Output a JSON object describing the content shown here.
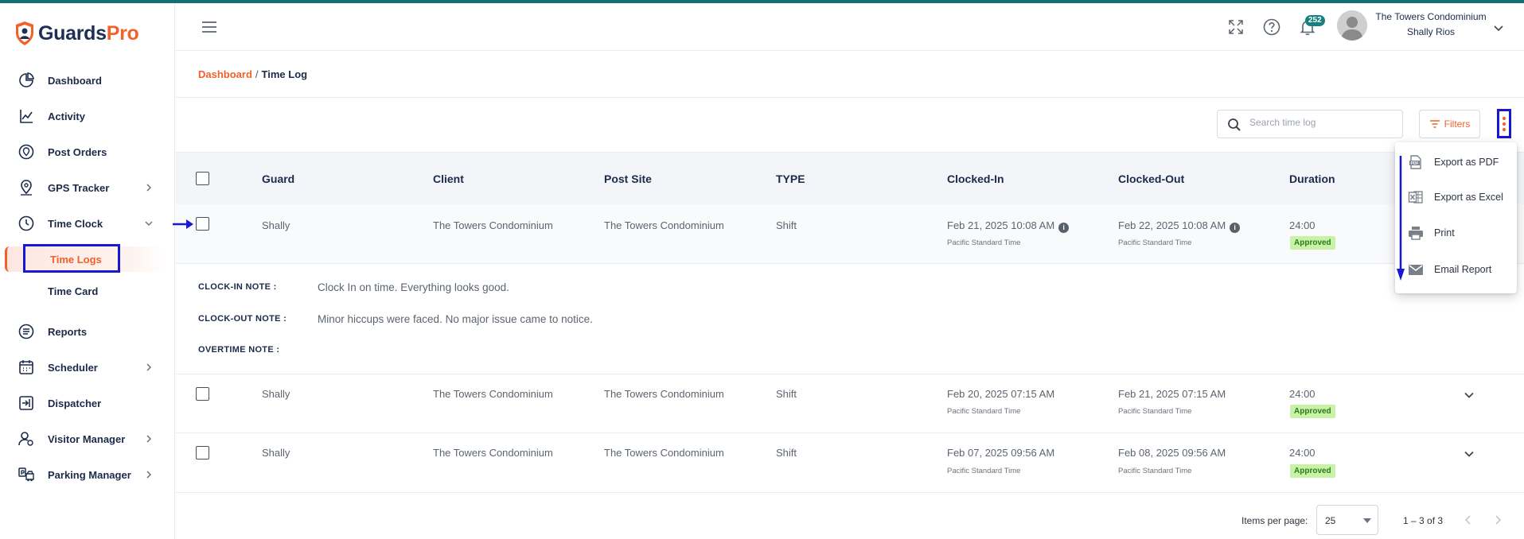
{
  "app": {
    "brand_part1": "Guards",
    "brand_part2": "Pro",
    "accent_color": "#f2612b",
    "annotation_color": "#1717d6"
  },
  "sidebar": {
    "items": [
      {
        "label": "Dashboard",
        "icon": "dashboard-icon"
      },
      {
        "label": "Activity",
        "icon": "activity-icon"
      },
      {
        "label": "Post Orders",
        "icon": "post-orders-icon"
      },
      {
        "label": "GPS Tracker",
        "icon": "gps-icon"
      },
      {
        "label": "Time Clock",
        "icon": "clock-icon"
      },
      {
        "label": "Reports",
        "icon": "reports-icon"
      },
      {
        "label": "Scheduler",
        "icon": "calendar-icon"
      },
      {
        "label": "Dispatcher",
        "icon": "dispatcher-icon"
      },
      {
        "label": "Visitor Manager",
        "icon": "visitor-icon"
      },
      {
        "label": "Parking Manager",
        "icon": "parking-icon"
      }
    ],
    "sub_items": [
      {
        "label": "Time Logs"
      },
      {
        "label": "Time Card"
      }
    ]
  },
  "header": {
    "notification_count": "252",
    "org_name": "The Towers Condominium",
    "user_name": "Shally Rios"
  },
  "breadcrumb": {
    "root": "Dashboard",
    "separator": "/",
    "current": "Time Log"
  },
  "toolbar": {
    "search_placeholder": "Search time log",
    "filters_label": "Filters"
  },
  "table": {
    "columns": [
      "Guard",
      "Client",
      "Post Site",
      "TYPE",
      "Clocked-In",
      "Clocked-Out",
      "Duration"
    ],
    "rows": [
      {
        "guard": "Shally",
        "client": "The Towers Condominium",
        "post_site": "The Towers Condominium",
        "type": "Shift",
        "clocked_in": "Feb 21, 2025 10:08 AM",
        "clocked_in_tz": "Pacific Standard Time",
        "clocked_out": "Feb 22, 2025 10:08 AM",
        "clocked_out_tz": "Pacific Standard Time",
        "duration": "24:00",
        "status": "Approved"
      },
      {
        "guard": "Shally",
        "client": "The Towers Condominium",
        "post_site": "The Towers Condominium",
        "type": "Shift",
        "clocked_in": "Feb 20, 2025 07:15 AM",
        "clocked_in_tz": "Pacific Standard Time",
        "clocked_out": "Feb 21, 2025 07:15 AM",
        "clocked_out_tz": "Pacific Standard Time",
        "duration": "24:00",
        "status": "Approved"
      },
      {
        "guard": "Shally",
        "client": "The Towers Condominium",
        "post_site": "The Towers Condominium",
        "type": "Shift",
        "clocked_in": "Feb 07, 2025 09:56 AM",
        "clocked_in_tz": "Pacific Standard Time",
        "clocked_out": "Feb 08, 2025 09:56 AM",
        "clocked_out_tz": "Pacific Standard Time",
        "duration": "24:00",
        "status": "Approved"
      }
    ],
    "notes": {
      "clock_in_label": "CLOCK-IN NOTE :",
      "clock_in_value": "Clock In on time. Everything looks good.",
      "clock_out_label": "CLOCK-OUT NOTE :",
      "clock_out_value": "Minor hiccups were faced. No major issue came to notice.",
      "overtime_label": "OVERTIME NOTE :",
      "overtime_value": ""
    }
  },
  "pagination": {
    "items_per_page_label": "Items per page:",
    "items_per_page": "25",
    "range": "1 – 3 of 3"
  },
  "export_menu": {
    "items": [
      {
        "label": "Export as PDF",
        "icon": "pdf-icon"
      },
      {
        "label": "Export as Excel",
        "icon": "excel-icon"
      },
      {
        "label": "Print",
        "icon": "printer-icon"
      },
      {
        "label": "Email Report",
        "icon": "email-icon"
      }
    ]
  }
}
